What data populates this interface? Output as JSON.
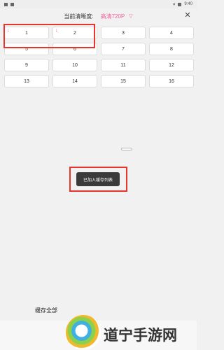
{
  "status": {
    "left_icons": [
      "signal-icon",
      "app-icon"
    ],
    "time": "9:40"
  },
  "header": {
    "label": "当前清晰度:",
    "value": "高清720P",
    "chevron": "▽",
    "close": "✕"
  },
  "episodes": [
    {
      "num": "1",
      "downloaded": true
    },
    {
      "num": "2",
      "downloaded": true
    },
    {
      "num": "3",
      "downloaded": false
    },
    {
      "num": "4",
      "downloaded": false
    },
    {
      "num": "5",
      "downloaded": false
    },
    {
      "num": "6",
      "downloaded": false
    },
    {
      "num": "7",
      "downloaded": false
    },
    {
      "num": "8",
      "downloaded": false
    },
    {
      "num": "9",
      "downloaded": false
    },
    {
      "num": "10",
      "downloaded": false
    },
    {
      "num": "11",
      "downloaded": false
    },
    {
      "num": "12",
      "downloaded": false
    },
    {
      "num": "13",
      "downloaded": false
    },
    {
      "num": "14",
      "downloaded": false
    },
    {
      "num": "15",
      "downloaded": false
    },
    {
      "num": "16",
      "downloaded": false
    }
  ],
  "toast": {
    "text": "已加入缓存列表"
  },
  "footer": {
    "cache_all": "缓存全部"
  },
  "watermark": {
    "text": "道宁手游网"
  }
}
